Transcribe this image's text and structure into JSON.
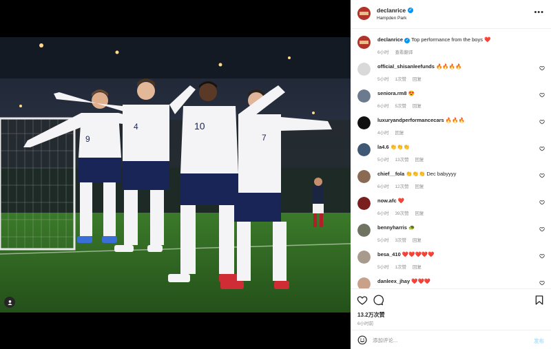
{
  "post": {
    "username": "declanrice",
    "location": "Hampden Park",
    "more_icon": "more-dots-icon",
    "caption": "Top performance from the boys ❤️",
    "caption_time": "6小时",
    "translate": "查看翻译",
    "likes": "13.2万次赞",
    "ago": "6小时前"
  },
  "labels": {
    "reply": "回复"
  },
  "comments": [
    {
      "user": "official_shisanleefunds",
      "text": "🔥🔥🔥🔥",
      "time": "5小时",
      "likes": "1次赞",
      "avatar_color": "#d9d9d9"
    },
    {
      "user": "seniora.rm8",
      "text": "😍",
      "time": "6小时",
      "likes": "5次赞",
      "avatar_color": "#6b7a8f"
    },
    {
      "user": "luxuryandperformancecars",
      "text": "🔥🔥🔥",
      "time": "4小时",
      "likes": "",
      "avatar_color": "#111111"
    },
    {
      "user": "la4.6",
      "text": "👏👏👏",
      "time": "5小时",
      "likes": "13次赞",
      "avatar_color": "#3f5873"
    },
    {
      "user": "chief__fola",
      "text": "👏👏👏 Dec babyyyy",
      "time": "6小时",
      "likes": "12次赞",
      "avatar_color": "#8a6a52"
    },
    {
      "user": "now.afc",
      "text": "❤️",
      "time": "6小时",
      "likes": "39次赞",
      "avatar_color": "#7a1f1f"
    },
    {
      "user": "bennyharris",
      "text": "🐢",
      "time": "5小时",
      "likes": "3次赞",
      "avatar_color": "#6f7460"
    },
    {
      "user": "besa_410",
      "text": "❤️❤️❤️❤️❤️",
      "time": "5小时",
      "likes": "1次赞",
      "avatar_color": "#a89a8c"
    },
    {
      "user": "danleex_jhay",
      "text": "❤️❤️❤️",
      "time": "",
      "likes": "",
      "avatar_color": "#c9a08a"
    }
  ],
  "composer": {
    "placeholder": "添加评论...",
    "post_label": "发布"
  }
}
